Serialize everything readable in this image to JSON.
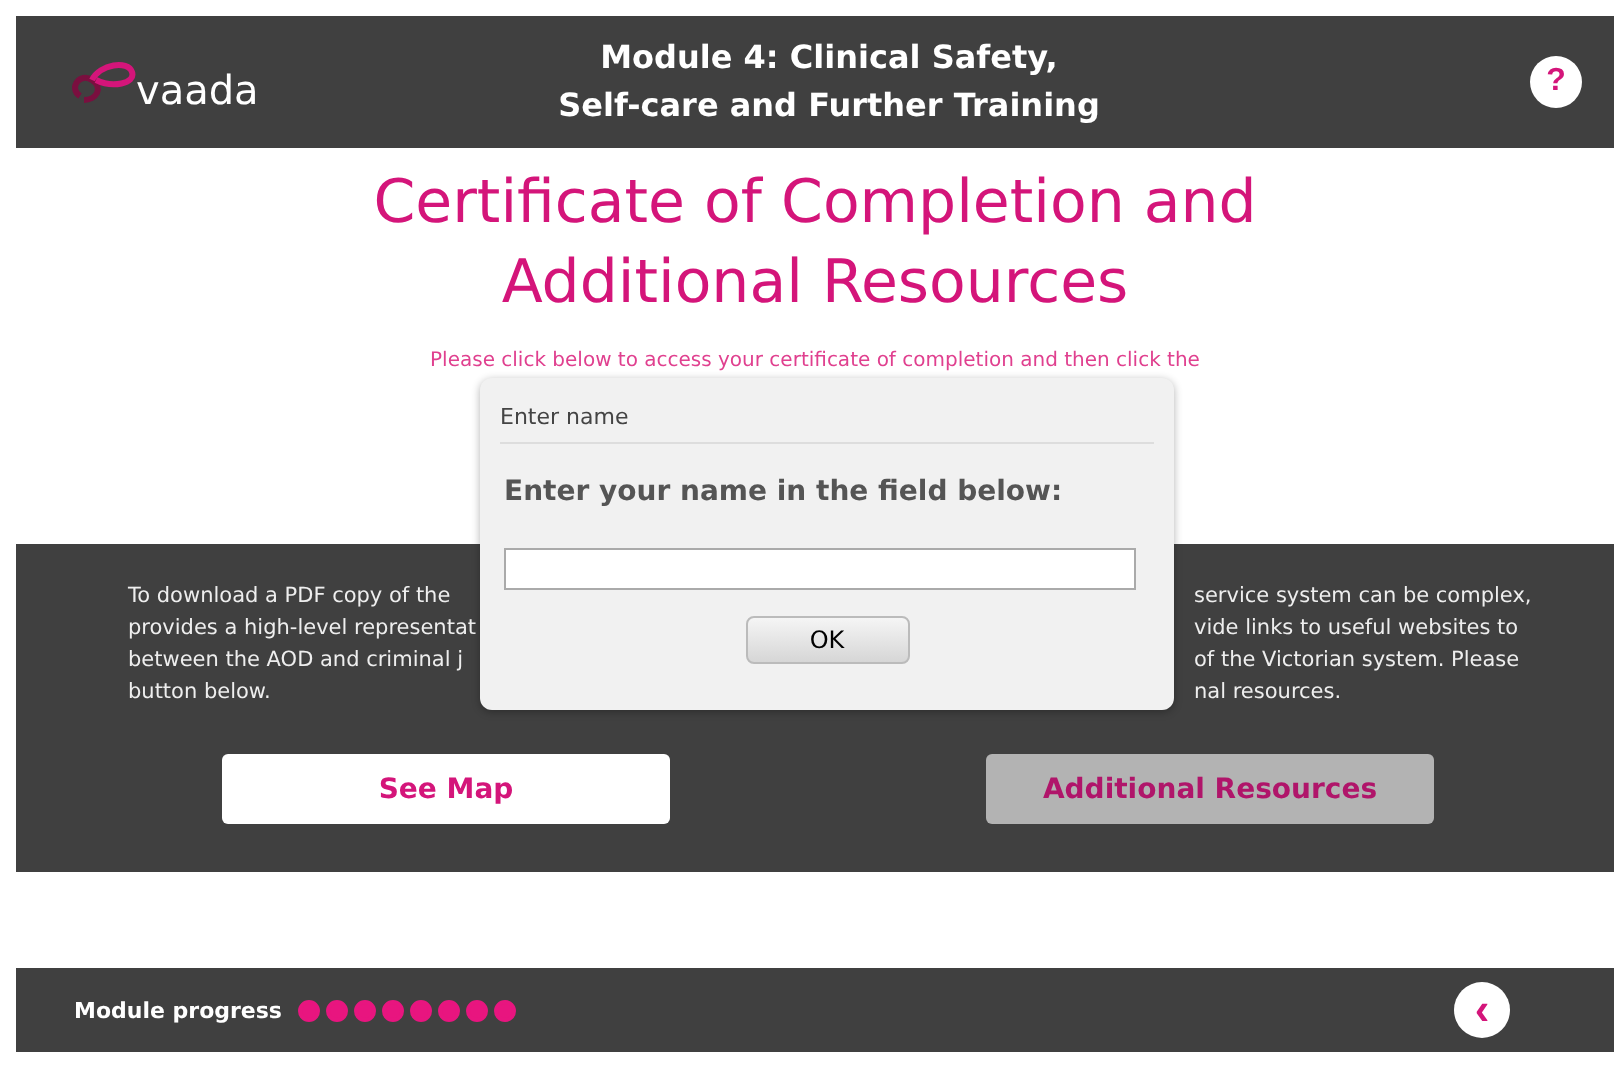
{
  "header": {
    "logo_text": "vaada",
    "title_lines": [
      "Module 4: Clinical Safety,",
      "Self-care and Further Training"
    ],
    "help": "?"
  },
  "heading_lines": [
    "Certificate of Completion and",
    "Additional Resources"
  ],
  "instruction": "Please click below to access your certificate of completion and then click the",
  "panel": {
    "left_lines": [
      "To download a PDF copy of the",
      "provides a high-level representat",
      "between the AOD and criminal j",
      "button below."
    ],
    "right_lines": [
      "service system can be complex,",
      "vide links to useful websites to",
      "of the Victorian system. Please",
      "nal resources."
    ],
    "buttons": [
      {
        "label": "See Map",
        "disabled": false
      },
      {
        "label": "Additional Resources",
        "disabled": true
      }
    ]
  },
  "dialog": {
    "title": "Enter name",
    "prompt": "Enter your name in the field below:",
    "button": "OK"
  },
  "footer": {
    "label": "Module progress",
    "dots": [
      {
        "completed": true
      },
      {
        "completed": true
      },
      {
        "completed": true
      },
      {
        "completed": true
      },
      {
        "completed": true
      },
      {
        "completed": true
      },
      {
        "completed": true
      },
      {
        "completed": true
      }
    ],
    "back": "‹"
  }
}
